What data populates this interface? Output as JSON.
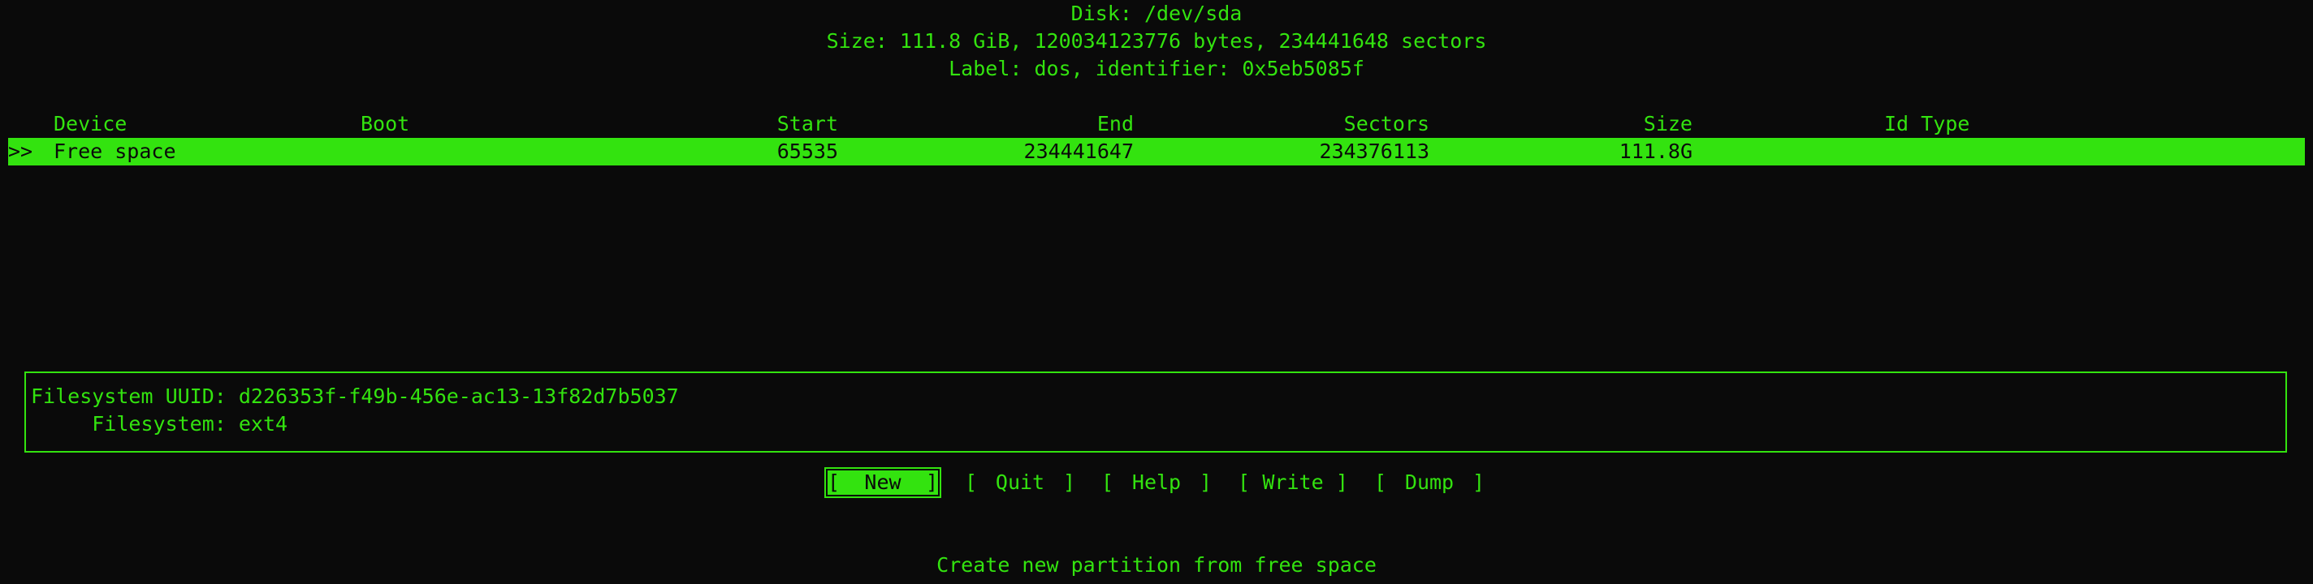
{
  "disk": {
    "title": "Disk: /dev/sda",
    "size_line": "Size: 111.8 GiB, 120034123776 bytes, 234441648 sectors",
    "label_line": "Label: dos, identifier: 0x5eb5085f"
  },
  "table": {
    "headers": {
      "device": "Device",
      "boot": "Boot",
      "start": "Start",
      "end": "End",
      "sectors": "Sectors",
      "size": "Size",
      "id_type": "Id Type"
    },
    "rows": [
      {
        "cursor": ">>",
        "device": "Free space",
        "boot": "",
        "start": "65535",
        "end": "234441647",
        "sectors": "234376113",
        "size": "111.8G",
        "id_type": ""
      }
    ]
  },
  "info": {
    "uuid_line": "Filesystem UUID: d226353f-f49b-456e-ac13-13f82d7b5037",
    "fs_line": "     Filesystem: ext4"
  },
  "menu": {
    "items": [
      {
        "label": "New",
        "selected": true
      },
      {
        "label": "Quit",
        "selected": false
      },
      {
        "label": "Help",
        "selected": false
      },
      {
        "label": "Write",
        "selected": false
      },
      {
        "label": "Dump",
        "selected": false
      }
    ],
    "open_bracket": "[",
    "close_bracket": "]"
  },
  "hint": "Create new partition from free space",
  "colors": {
    "foreground": "#33e30f",
    "background": "#0a0a0a"
  }
}
